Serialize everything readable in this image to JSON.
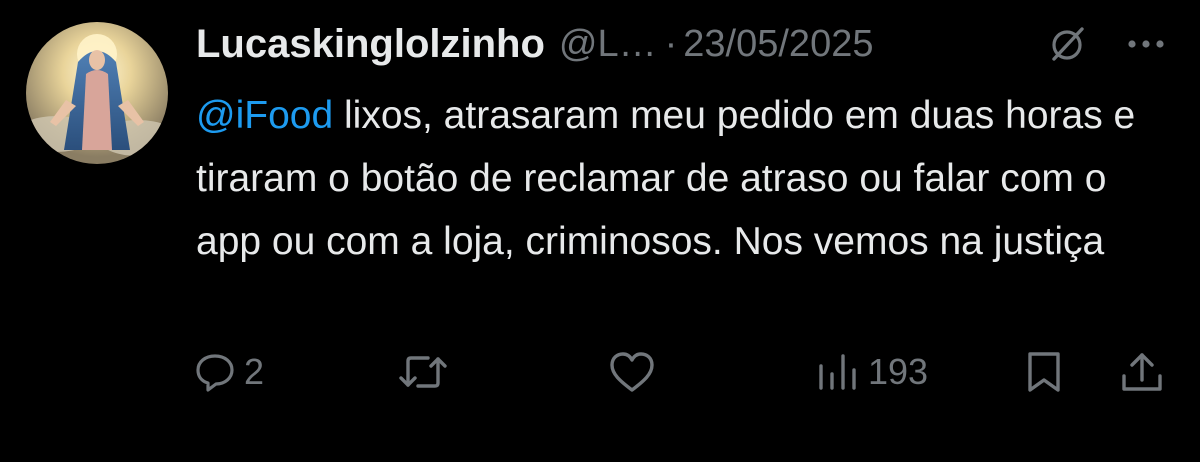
{
  "author": {
    "display_name": "Lucaskinglolzinho",
    "handle": "@L…",
    "separator": "·",
    "date": "23/05/2025"
  },
  "tweet": {
    "mention": "@iFood",
    "text": " lixos, atrasaram meu pedido em duas horas e tiraram o botão de reclamar de atraso ou falar com o app ou com a loja, criminosos. Nos vemos na justiça"
  },
  "actions": {
    "replies": "2",
    "views": "193"
  },
  "icons": {
    "reply": "reply-icon",
    "retweet": "retweet-icon",
    "like": "heart-icon",
    "views": "views-chart-icon",
    "bookmark": "bookmark-icon",
    "share": "share-icon",
    "grok": "grok-icon",
    "more": "more-icon"
  },
  "colors": {
    "background": "#000000",
    "text": "#e7e9ea",
    "muted": "#71767b",
    "mention": "#1d9bf0"
  }
}
